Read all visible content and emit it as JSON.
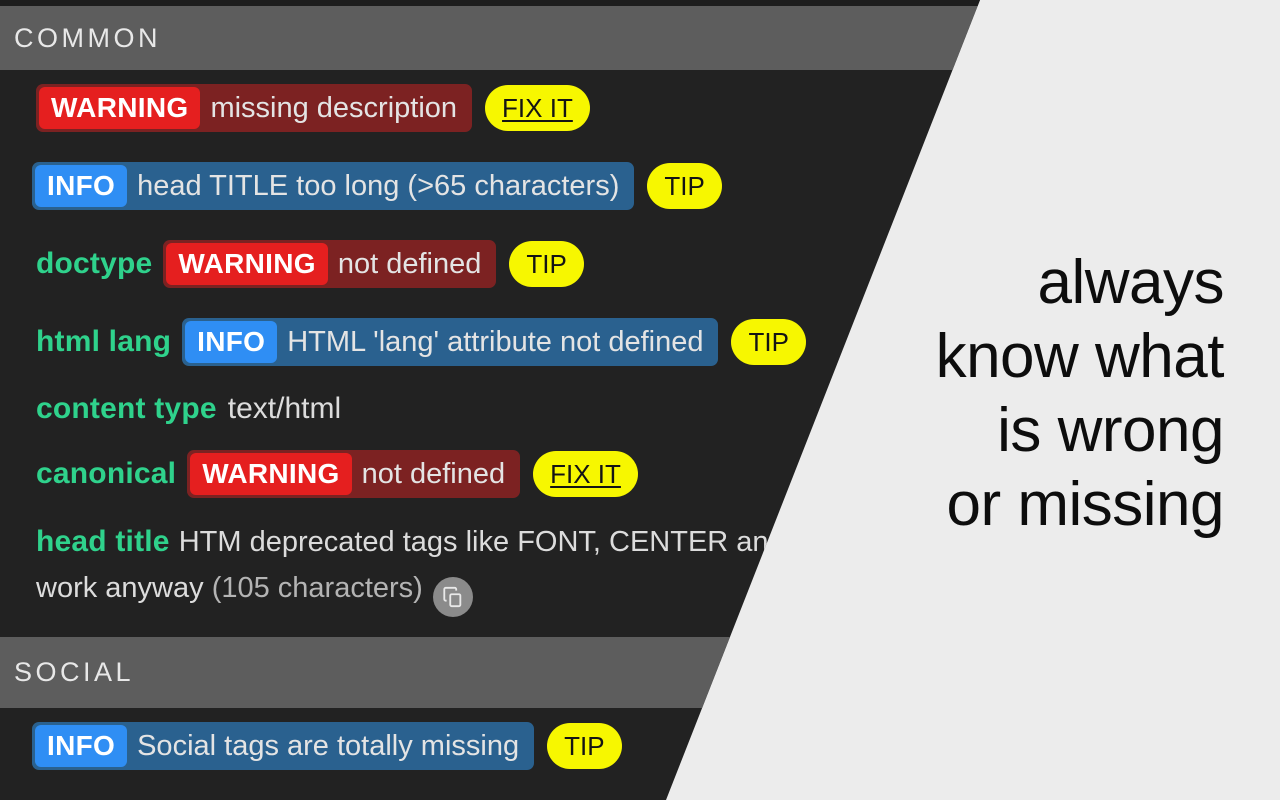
{
  "colors": {
    "panel_bg": "#222222",
    "section_header_bg": "#5d5d5d",
    "key_green": "#2fd28c",
    "warning_badge": "#e51f1f",
    "warning_bg": "#7c2222",
    "info_badge": "#2f8ef4",
    "info_bg": "#2a618f",
    "pill_yellow": "#f7f700",
    "right_bg": "#ececec"
  },
  "sections": [
    {
      "id": "common",
      "title": "COMMON"
    },
    {
      "id": "social",
      "title": "SOCIAL"
    }
  ],
  "common_rows": [
    {
      "key": "",
      "badge": "WARNING",
      "level": "warning",
      "message": "missing description",
      "action": "FIX IT"
    },
    {
      "key": "",
      "badge": "INFO",
      "level": "info",
      "message": "head TITLE too long (>65 characters)",
      "action": "TIP"
    },
    {
      "key": "doctype",
      "badge": "WARNING",
      "level": "warning",
      "message": "not defined",
      "action": "TIP"
    },
    {
      "key": "html lang",
      "badge": "INFO",
      "level": "info",
      "message": "HTML 'lang' attribute not defined",
      "action": "TIP"
    },
    {
      "key": "content type",
      "badge": "",
      "level": "none",
      "message": "text/html",
      "action": ""
    },
    {
      "key": "canonical",
      "badge": "WARNING",
      "level": "warning",
      "message": "not defined",
      "action": "FIX IT"
    }
  ],
  "head_title_row": {
    "key": "head title",
    "value": "HTM deprecated tags like FONT, CENTER and STRIKE still work anyway",
    "charcount": "(105 characters)",
    "copy_icon": "copy-icon"
  },
  "social_rows": [
    {
      "key": "",
      "badge": "INFO",
      "level": "info",
      "message": "Social tags are totally missing",
      "action": "TIP"
    }
  ],
  "caption": {
    "line1": "always",
    "line2": "know what",
    "line3": "is wrong",
    "line4": "or missing"
  }
}
